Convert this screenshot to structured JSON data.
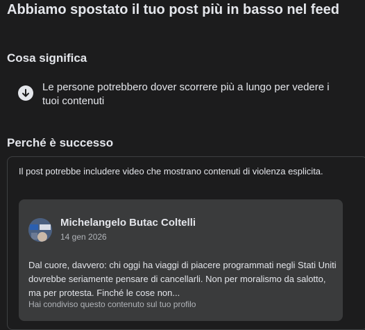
{
  "title": "Abbiamo spostato il tuo post più in basso nel feed",
  "meaning": {
    "heading": "Cosa significa",
    "icon": "arrow-down-icon",
    "text": "Le persone potrebbero dover scorrere più a lungo per vedere i tuoi contenuti"
  },
  "reason": {
    "heading": "Perché è successo",
    "text": "Il post potrebbe includere video che mostrano contenuti di violenza esplicita."
  },
  "post": {
    "author": "Michelangelo Butac Coltelli",
    "date": "14 gen 2026",
    "body": "Dal cuore, davvero: chi oggi ha viaggi di piacere programmati negli Stati Uniti dovrebbe seriamente pensare di cancellarli. Non per moralismo da salotto, ma per protesta. Finché le cose non...",
    "shared_note": "Hai condiviso questo contenuto sul tuo profilo"
  }
}
